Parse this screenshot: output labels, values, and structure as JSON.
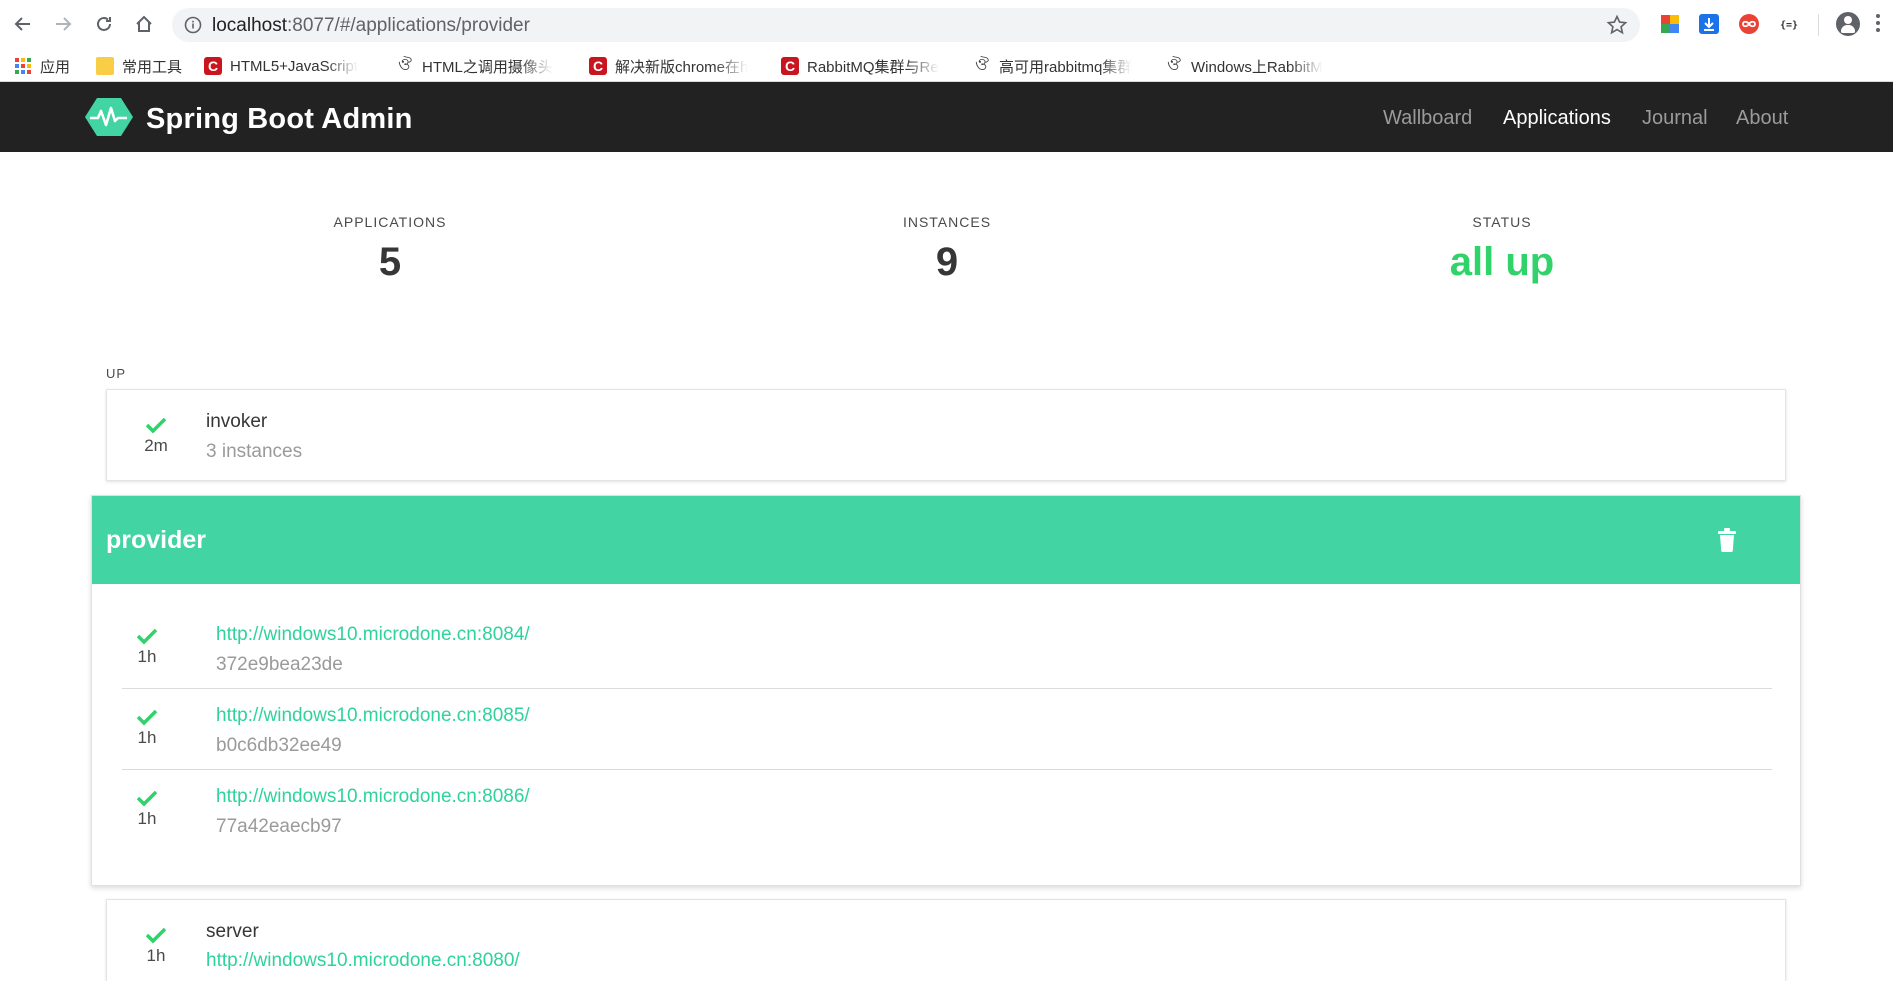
{
  "browser": {
    "url_host": "localhost",
    "url_path": ":8077/#/applications/provider",
    "bookmarks": [
      {
        "label": "应用",
        "icon": "apps-grid-icon"
      },
      {
        "label": "常用工具",
        "icon": "folder-icon"
      },
      {
        "label": "HTML5+JavaScript",
        "icon": "csdn-icon"
      },
      {
        "label": "HTML之调用摄像头",
        "icon": "webstorm-icon"
      },
      {
        "label": "解决新版chrome在h",
        "icon": "csdn-icon"
      },
      {
        "label": "RabbitMQ集群与Re",
        "icon": "csdn-icon"
      },
      {
        "label": "高可用rabbitmq集群",
        "icon": "webstorm-icon"
      },
      {
        "label": "Windows上RabbitM",
        "icon": "webstorm-icon"
      }
    ]
  },
  "navbar": {
    "brand": "Spring Boot Admin",
    "items": [
      {
        "label": "Wallboard",
        "active": false
      },
      {
        "label": "Applications",
        "active": true
      },
      {
        "label": "Journal",
        "active": false
      },
      {
        "label": "About",
        "active": false
      }
    ]
  },
  "summary": {
    "applications_label": "APPLICATIONS",
    "applications_value": "5",
    "instances_label": "INSTANCES",
    "instances_value": "9",
    "status_label": "STATUS",
    "status_value": "all up"
  },
  "group": {
    "label": "UP"
  },
  "applications": [
    {
      "name": "invoker",
      "age": "2m",
      "subtitle": "3 instances"
    }
  ],
  "provider": {
    "name": "provider",
    "instances": [
      {
        "url": "http://windows10.microdone.cn:8084/",
        "id": "372e9bea23de",
        "age": "1h"
      },
      {
        "url": "http://windows10.microdone.cn:8085/",
        "id": "b0c6db32ee49",
        "age": "1h"
      },
      {
        "url": "http://windows10.microdone.cn:8086/",
        "id": "77a42eaecb97",
        "age": "1h"
      }
    ]
  },
  "server_app": {
    "name": "server",
    "age": "1h",
    "url": "http://windows10.microdone.cn:8080/"
  },
  "colors": {
    "navbar_bg": "#222222",
    "accent_green": "#42d4a2",
    "status_green": "#2fd36a",
    "link_green": "#2fd39a"
  }
}
